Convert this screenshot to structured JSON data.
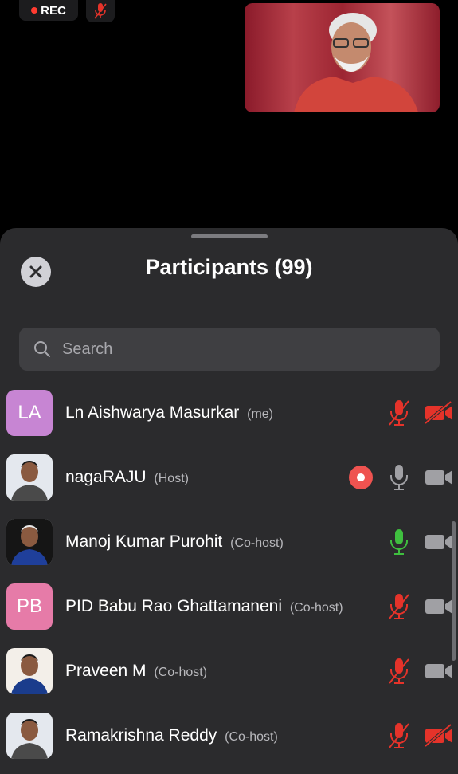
{
  "top": {
    "rec_label": "REC"
  },
  "panel": {
    "title": "Participants (99)",
    "search_placeholder": "Search"
  },
  "participants": [
    {
      "initials": "LA",
      "avatar_color": "#c785d3",
      "name": "Ln Aishwarya Masurkar",
      "role": "(me)",
      "mic": "muted",
      "camera": "off",
      "recording": false
    },
    {
      "initials": "",
      "avatar_color": "#ece8e4",
      "name": "nagaRAJU",
      "role": "(Host)",
      "mic": "on",
      "camera": "on",
      "recording": true
    },
    {
      "initials": "",
      "avatar_color": "#d9dfe8",
      "name": "Manoj Kumar Purohit",
      "role": "(Co-host)",
      "mic": "speaking",
      "camera": "on",
      "recording": false
    },
    {
      "initials": "PB",
      "avatar_color": "#e67ba8",
      "name": "PID Babu Rao Ghattamaneni",
      "role": "(Co-host)",
      "mic": "muted",
      "camera": "on",
      "recording": false
    },
    {
      "initials": "",
      "avatar_color": "#2a2a2a",
      "name": "Praveen M",
      "role": "(Co-host)",
      "mic": "muted",
      "camera": "on",
      "recording": false
    },
    {
      "initials": "",
      "avatar_color": "#d8d4cc",
      "name": "Ramakrishna Reddy",
      "role": "(Co-host)",
      "mic": "muted",
      "camera": "off",
      "recording": false
    }
  ],
  "colors": {
    "muted_red": "#e5332a",
    "speaking_green": "#3fbf3f",
    "icon_gray": "#a0a0a4"
  }
}
